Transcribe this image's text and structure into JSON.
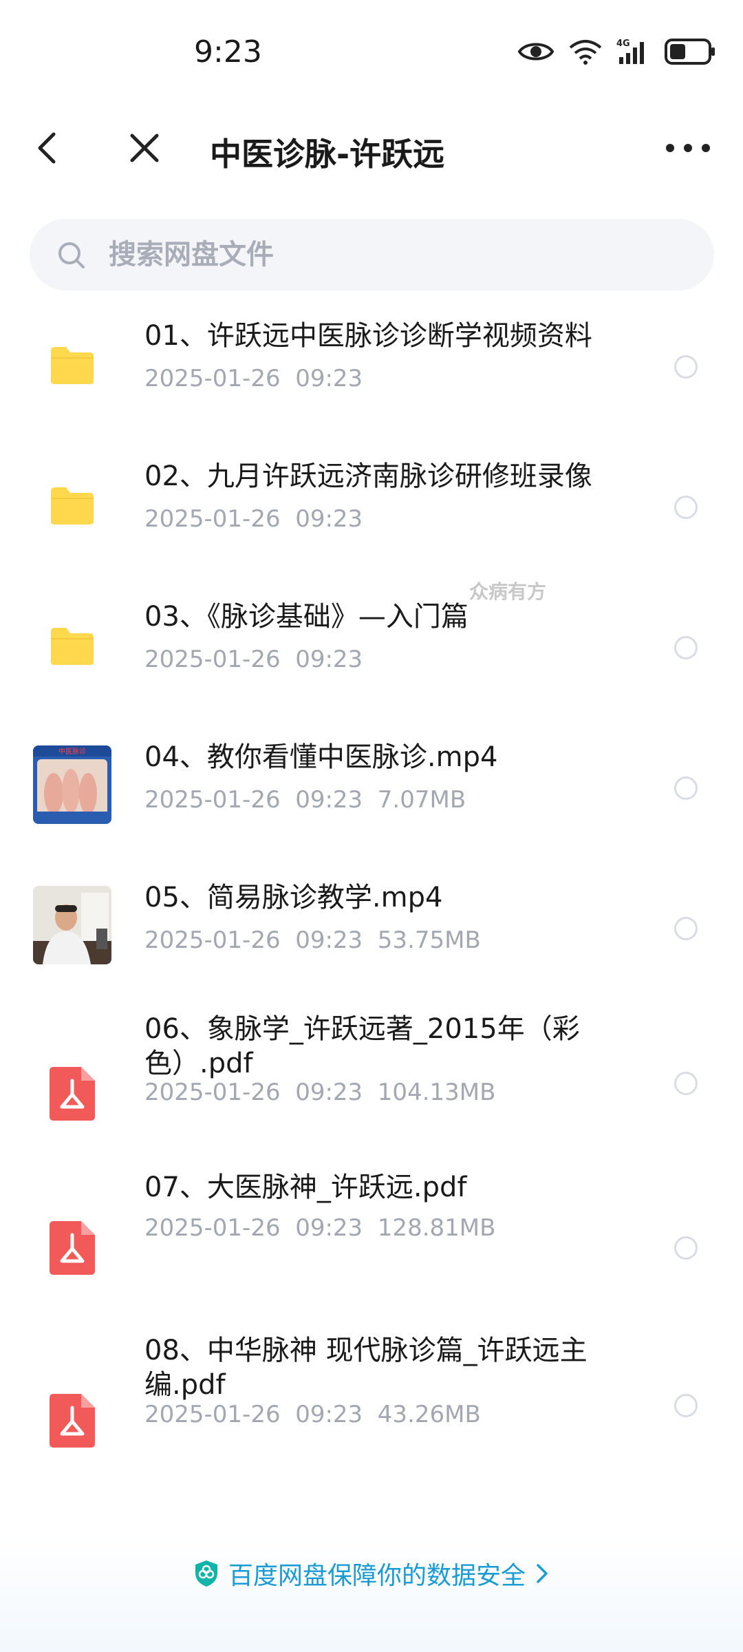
{
  "status_bar": {
    "time": "9:23",
    "network": "4G",
    "icons": [
      "eye-icon",
      "wifi-icon",
      "signal-icon",
      "battery-icon"
    ]
  },
  "header": {
    "title": "中医诊脉-许跃远",
    "back_icon": "back-arrow-icon",
    "close_icon": "close-icon",
    "more_icon": "more-dots-icon"
  },
  "search": {
    "placeholder": "搜索网盘文件",
    "value": ""
  },
  "watermark": "众病有方",
  "files": [
    {
      "name": "01、许跃远中医脉诊诊断学视频资料",
      "date": "2025-01-26",
      "time": "09:23",
      "size": "",
      "type": "folder"
    },
    {
      "name": "02、九月许跃远济南脉诊研修班录像",
      "date": "2025-01-26",
      "time": "09:23",
      "size": "",
      "type": "folder"
    },
    {
      "name": "03、《脉诊基础》—入门篇",
      "date": "2025-01-26",
      "time": "09:23",
      "size": "",
      "type": "folder"
    },
    {
      "name": "04、教你看懂中医脉诊.mp4",
      "date": "2025-01-26",
      "time": "09:23",
      "size": "7.07MB",
      "type": "video",
      "thumb_label": "中医脉诊"
    },
    {
      "name": "05、简易脉诊教学.mp4",
      "date": "2025-01-26",
      "time": "09:23",
      "size": "53.75MB",
      "type": "video"
    },
    {
      "name": "06、象脉学_许跃远著_2015年（彩色）.pdf",
      "date": "2025-01-26",
      "time": "09:23",
      "size": "104.13MB",
      "type": "pdf"
    },
    {
      "name": "07、大医脉神_许跃远.pdf",
      "date": "2025-01-26",
      "time": "09:23",
      "size": "128.81MB",
      "type": "pdf"
    },
    {
      "name": "08、中华脉神  现代脉诊篇_许跃远主编.pdf",
      "date": "2025-01-26",
      "time": "09:23",
      "size": "43.26MB",
      "type": "pdf"
    }
  ],
  "meta_lines": [
    "2025-01-26  09:23",
    "2025-01-26  09:23",
    "2025-01-26  09:23",
    "2025-01-26  09:23  7.07MB",
    "2025-01-26  09:23  53.75MB",
    "2025-01-26  09:23  104.13MB",
    "2025-01-26  09:23  128.81MB",
    "2025-01-26  09:23  43.26MB"
  ],
  "footer": {
    "security_text": "百度网盘保障你的数据安全"
  },
  "colors": {
    "folder": "#ffd84d",
    "pdf": "#f25a5a",
    "link": "#1a9bd4",
    "meta": "#a2a7b0"
  }
}
